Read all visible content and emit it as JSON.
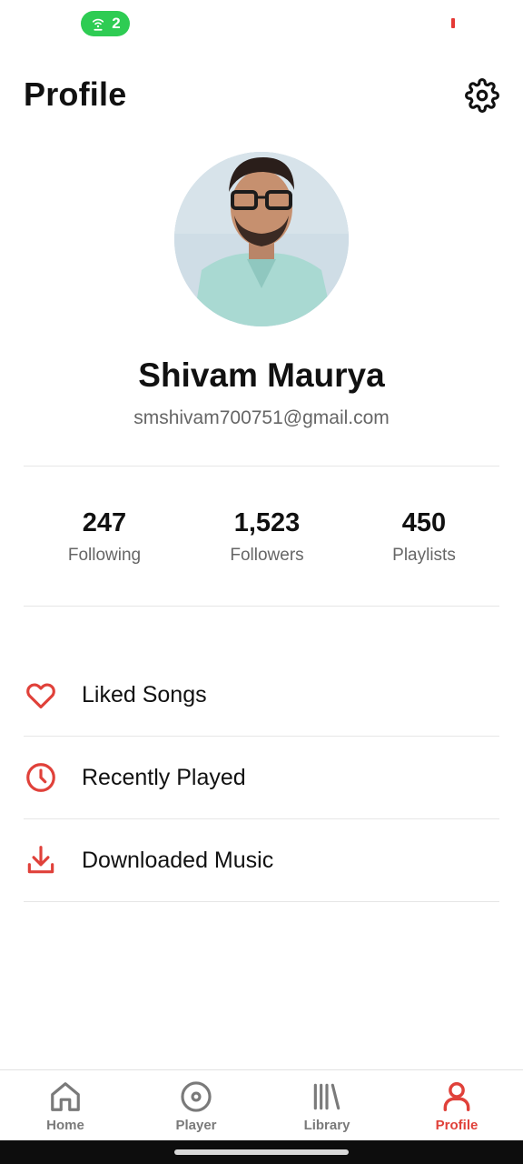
{
  "status_bar": {
    "hotspot_count": "2"
  },
  "header": {
    "title": "Profile"
  },
  "profile": {
    "name": "Shivam Maurya",
    "email": "smshivam700751@gmail.com"
  },
  "stats": [
    {
      "value": "247",
      "label": "Following"
    },
    {
      "value": "1,523",
      "label": "Followers"
    },
    {
      "value": "450",
      "label": "Playlists"
    }
  ],
  "menu": [
    {
      "label": "Liked Songs",
      "icon": "heart-icon"
    },
    {
      "label": "Recently Played",
      "icon": "clock-icon"
    },
    {
      "label": "Downloaded Music",
      "icon": "download-icon"
    }
  ],
  "bottom_nav": [
    {
      "label": "Home",
      "icon": "home-icon",
      "active": false
    },
    {
      "label": "Player",
      "icon": "disc-icon",
      "active": false
    },
    {
      "label": "Library",
      "icon": "library-icon",
      "active": false
    },
    {
      "label": "Profile",
      "icon": "person-icon",
      "active": true
    }
  ],
  "colors": {
    "accent": "#e0413a",
    "hotspot": "#2ecc53",
    "text_primary": "#111111",
    "text_secondary": "#666666",
    "nav_inactive": "#7a7a7a"
  }
}
